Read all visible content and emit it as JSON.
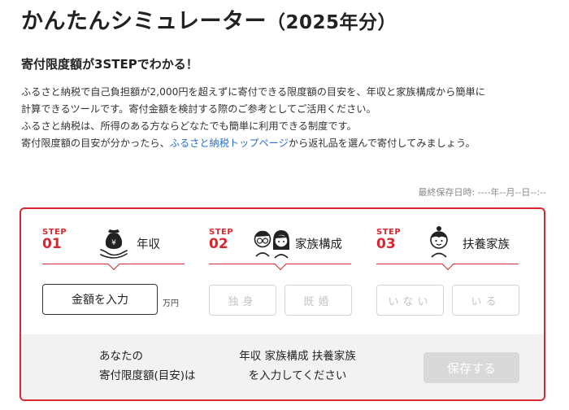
{
  "header": {
    "title": "かんたんシミュレーター",
    "title_year": "（2025年分）"
  },
  "intro": {
    "subtitle": "寄付限度額が3STEPでわかる！",
    "lines": [
      "ふるさと納税で自己負担額が2,000円を超えずに寄付できる限度額の目安を、年収と家族構成から簡単に",
      "計算できるツールです。寄付金額を検討する際のご参考としてご活用ください。",
      "ふるさと納税は、所得のある方ならどなたでも簡単に利用できる制度です。"
    ],
    "line4_prefix": "寄付限度額の目安が分かったら、",
    "line4_link": "ふるさと納税トップページ",
    "line4_suffix": "から返礼品を選んで寄付してみましょう。"
  },
  "saved": {
    "text": "最終保存日時: ----年--月--日--:--"
  },
  "steps": [
    {
      "word": "STEP",
      "number": "01",
      "label": "年収",
      "icon": "money-bag-hand-icon"
    },
    {
      "word": "STEP",
      "number": "02",
      "label": "家族構成",
      "icon": "couple-icon"
    },
    {
      "word": "STEP",
      "number": "03",
      "label": "扶養家族",
      "icon": "child-icon"
    }
  ],
  "income": {
    "button_label": "金額を入力",
    "unit": "万円"
  },
  "family": {
    "single_label": "独身",
    "married_label": "既婚"
  },
  "dependents": {
    "none_label": "いない",
    "yes_label": "いる"
  },
  "result": {
    "label_line1": "あなたの",
    "label_line2": "寄付限度額(目安)は",
    "message_line1": "年収 家族構成 扶養家族",
    "message_line2": "を入力してください",
    "save_label": "保存する"
  },
  "colors": {
    "accent": "#d9262f",
    "link": "#2a6fc9",
    "disabled": "#d9d9d9",
    "result_bg": "#f2f2f2"
  }
}
